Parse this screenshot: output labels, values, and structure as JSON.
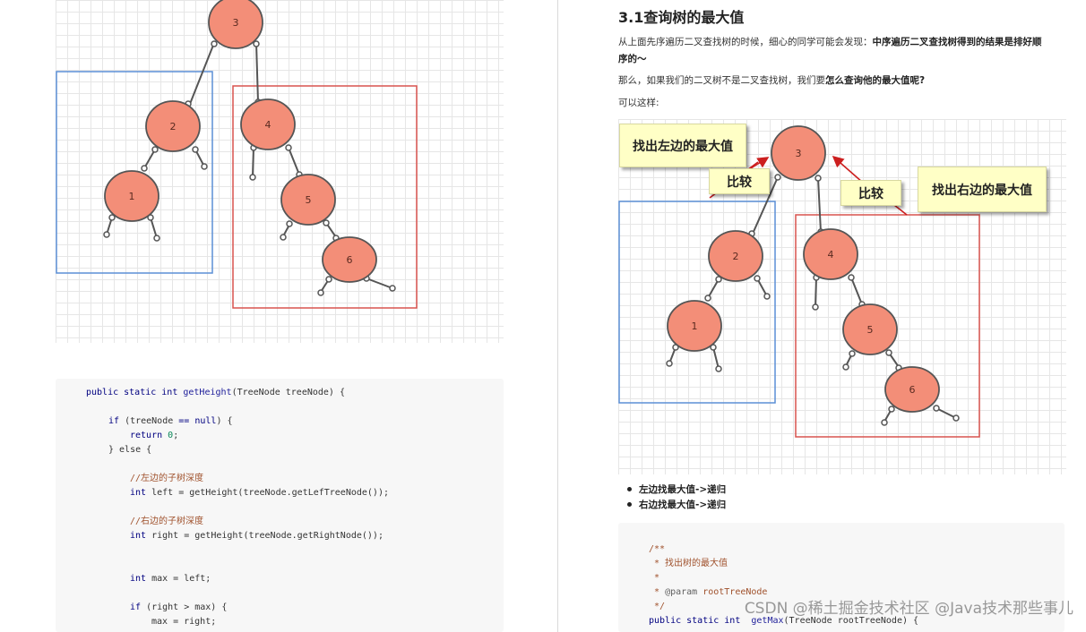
{
  "left_page": {
    "tree_nodes": [
      "3",
      "2",
      "4",
      "1",
      "5",
      "6"
    ],
    "code": {
      "line1": {
        "kw1": "public static int ",
        "fn": "getHeight",
        "rest": "(TreeNode treeNode) {"
      },
      "line2": {
        "kw": "if ",
        "rest1": "(treeNode ",
        "op": "==",
        "rest2": " ",
        "kw2": "null",
        "rest3": ") {"
      },
      "line3": {
        "kw": "return ",
        "num": "0",
        "rest": ";"
      },
      "line4": {
        "text": "} else {"
      },
      "line5": {
        "comment": "//左边的子树深度"
      },
      "line6": {
        "kw": "int ",
        "rest": "left = getHeight(treeNode.getLefTreeNode());"
      },
      "line7": {
        "comment": "//右边的子树深度"
      },
      "line8": {
        "kw": "int ",
        "rest": "right = getHeight(treeNode.getRightNode());"
      },
      "line9": {
        "kw": "int ",
        "rest": "max = left;"
      },
      "line10": {
        "kw": "if ",
        "rest": "(right > max) {"
      },
      "line11": {
        "text": "max = right;"
      }
    }
  },
  "right_page": {
    "title": "3.1查询树的最大值",
    "para1_normal": "从上面先序遍历二叉查找树的时候，细心的同学可能会发现：",
    "para1_bold_a": "中序遍历二叉查找树得到的结果是排好顺",
    "para1_bold_b": "序的～",
    "para2_a": "那么，如果我们的二叉树不是二叉查找树，我们要",
    "para2_bold": "怎么查询他的最大值呢?",
    "para3": "可以这样:",
    "callouts": {
      "left_max": "找出左边的最大值",
      "compare_left": "比较",
      "compare_right": "比较",
      "right_max": "找出右边的最大值"
    },
    "tree_nodes": [
      "3",
      "2",
      "4",
      "1",
      "5",
      "6"
    ],
    "bullets": [
      "左边找最大值->递归",
      "右边找最大值->递归"
    ],
    "code": {
      "line1": "/**",
      "line2": " * 找出树的最大值",
      "line3": " *",
      "line4_prefix": " * ",
      "line4_ann": "@param",
      "line4_rest": " rootTreeNode",
      "line5": " */",
      "line6_kw": "public static int  ",
      "line6_fn": "getMax",
      "line6_rest": "(TreeNode rootTreeNode) {"
    }
  },
  "watermark": "CSDN @稀土掘金技术社区 @Java技术那些事儿",
  "colors": {
    "node_fill": "#f38e78",
    "node_stroke": "#555555",
    "blue_box": "#5b8fd6",
    "red_box": "#d9534f",
    "arrow_red": "#cc1f1f",
    "callout_bg": "#ffffc6"
  }
}
